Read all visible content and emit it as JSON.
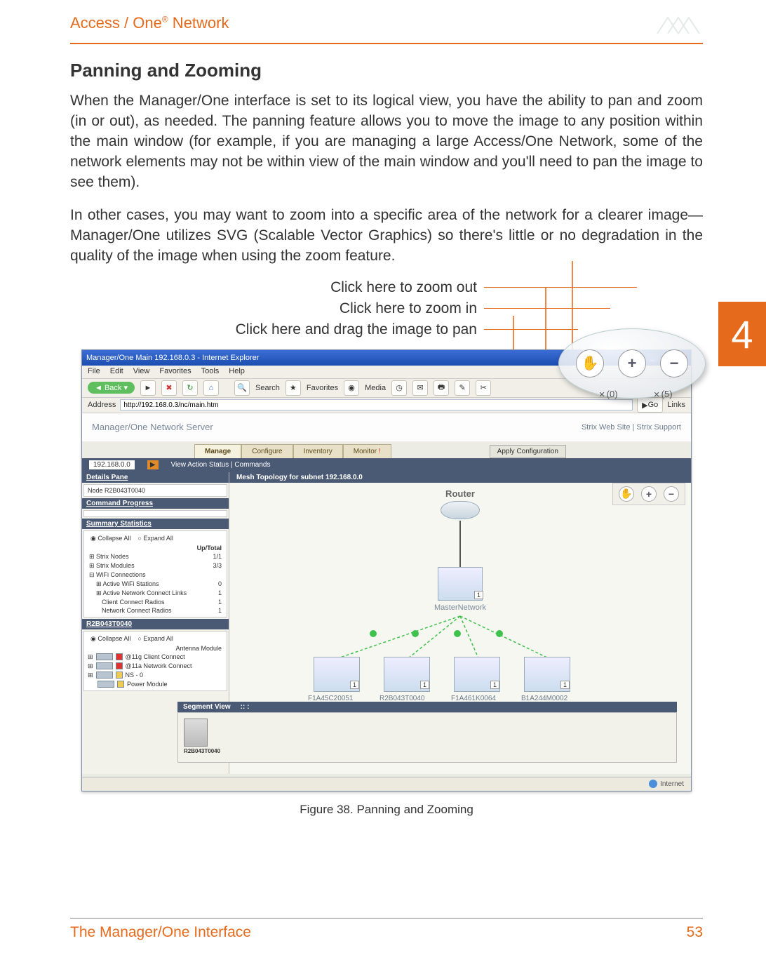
{
  "header": {
    "product": "Access / One",
    "reg": "®",
    "suffix": " Network"
  },
  "section": {
    "title": "Panning and Zooming",
    "p1": "When the Manager/One interface is set to its logical view, you have the ability to pan and zoom (in or out), as needed. The panning feature allows you to move the image to any position within the main window (for example, if you are managing a large Access/One Network, some of the network elements may not be within view of the main window and you'll need to pan the image to see them).",
    "p2": "In other cases, you may want to zoom into a specific area of the network for a clearer image—Manager/One utilizes SVG (Scalable Vector Graphics) so there's little or no degradation in the quality of the image when using the zoom feature."
  },
  "sideTab": "4",
  "annot": {
    "zoomOut": "Click here to zoom out",
    "zoomIn": "Click here to zoom in",
    "pan": "Click here and drag the image to pan"
  },
  "shot": {
    "title": "Manager/One Main 192.168.0.3 - Internet Explorer",
    "menu": [
      "File",
      "Edit",
      "View",
      "Favorites",
      "Tools",
      "Help"
    ],
    "back": "Back",
    "toolbar": [
      "Search",
      "Favorites",
      "Media"
    ],
    "addressLabel": "Address",
    "url": "http://192.168.0.3/nc/main.htm",
    "go": "Go",
    "links": "Links",
    "brand": "Manager/One Network Server",
    "brandLinks": "Strix Web Site   |   Strix Support",
    "tabs": [
      "Manage",
      "Configure",
      "Inventory",
      "Monitor"
    ],
    "apply": "Apply Configuration",
    "ip": "192.168.0.0",
    "subnav": "View Action Status   |   Commands",
    "detailsPane": "Details Pane",
    "node": "Node R2B043T0040",
    "cmdProgress": "Command Progress",
    "summaryStats": "Summary Statistics",
    "collapse": "Collapse All",
    "expand": "Expand All",
    "upTotal": "Up/Total",
    "stats": [
      {
        "k": "Strix Nodes",
        "v": "1/1"
      },
      {
        "k": "Strix Modules",
        "v": "3/3"
      },
      {
        "k": "WiFi Connections",
        "v": ""
      },
      {
        "k": "Active WiFi Stations",
        "v": "0"
      },
      {
        "k": "Active Network Connect Links",
        "v": "1"
      },
      {
        "k": "Client Connect Radios",
        "v": "1"
      },
      {
        "k": "Network Connect Radios",
        "v": "1"
      }
    ],
    "nodeHdr": "R2B043T0040",
    "antenna": "Antenna Module",
    "mods": [
      "@11g Client Connect",
      "@11a Network Connect",
      "NS - 0",
      "Power Module"
    ],
    "meshHdr": "Mesh Topology for subnet 192.168.0.0",
    "router": "Router",
    "master": "MasterNetwork",
    "masterBadge": "1",
    "leaves": [
      "F1A45C20051",
      "R2B043T0040",
      "F1A461K0064",
      "B1A244M0002"
    ],
    "leafBadge": "1",
    "segView": "Segment View",
    "segDots": ":: :",
    "segDev": "R2B043T0040",
    "bubbleCounts": [
      "(0)",
      "(5)"
    ],
    "statusNet": "Internet"
  },
  "caption": "Figure 38. Panning and Zooming",
  "footer": {
    "left": "The Manager/One Interface",
    "right": "53"
  }
}
